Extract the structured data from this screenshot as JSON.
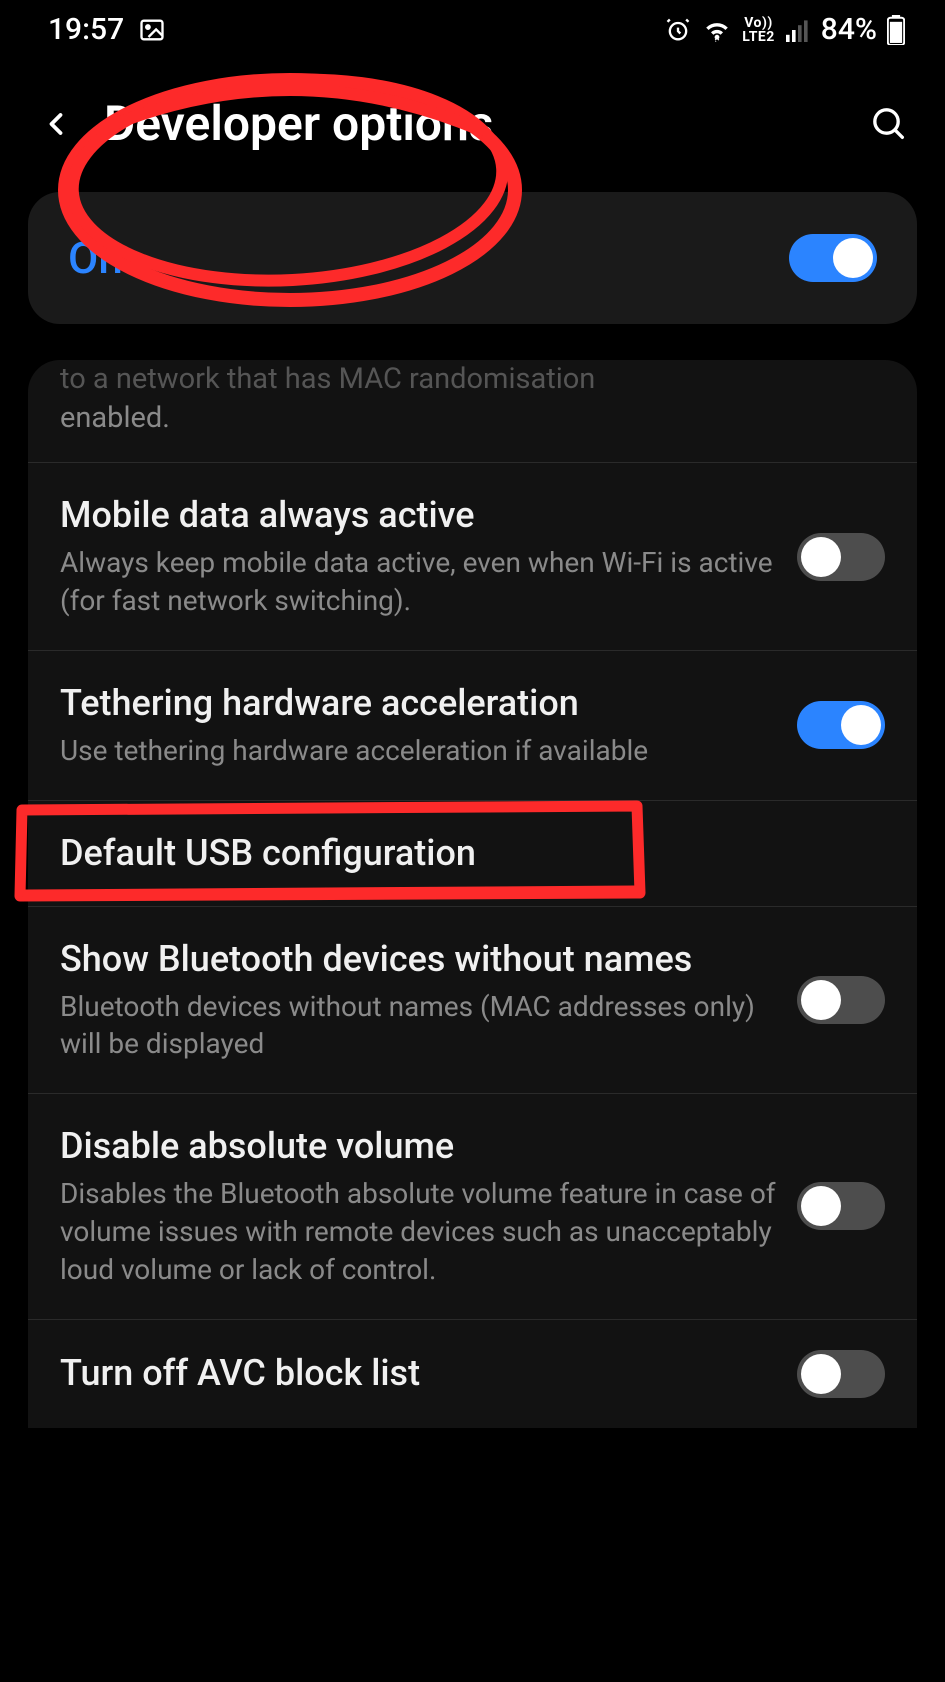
{
  "status": {
    "time": "19:57",
    "battery": "84%"
  },
  "header": {
    "title": "Developer options"
  },
  "master": {
    "label": "On",
    "checked": true
  },
  "partial": {
    "text_upper": "to a network that has MAC randomisation",
    "text_lower": "enabled."
  },
  "rows": [
    {
      "title": "Mobile data always active",
      "sub": "Always keep mobile data active, even when Wi-Fi is active (for fast network switching).",
      "toggle": false
    },
    {
      "title": "Tethering hardware acceleration",
      "sub": "Use tethering hardware acceleration if available",
      "toggle": true
    },
    {
      "title": "Default USB configuration",
      "sub": "",
      "toggle": null
    },
    {
      "title": "Show Bluetooth devices without names",
      "sub": "Bluetooth devices without names (MAC addresses only) will be displayed",
      "toggle": false
    },
    {
      "title": "Disable absolute volume",
      "sub": "Disables the Bluetooth absolute volume feature in case of volume issues with remote devices such as unacceptably loud volume or lack of control.",
      "toggle": false
    },
    {
      "title": "Turn off AVC block list",
      "sub": "",
      "toggle": false
    }
  ],
  "annotation": {
    "circle_color": "#fd2a2a",
    "rect_color": "#fd2a2a"
  }
}
